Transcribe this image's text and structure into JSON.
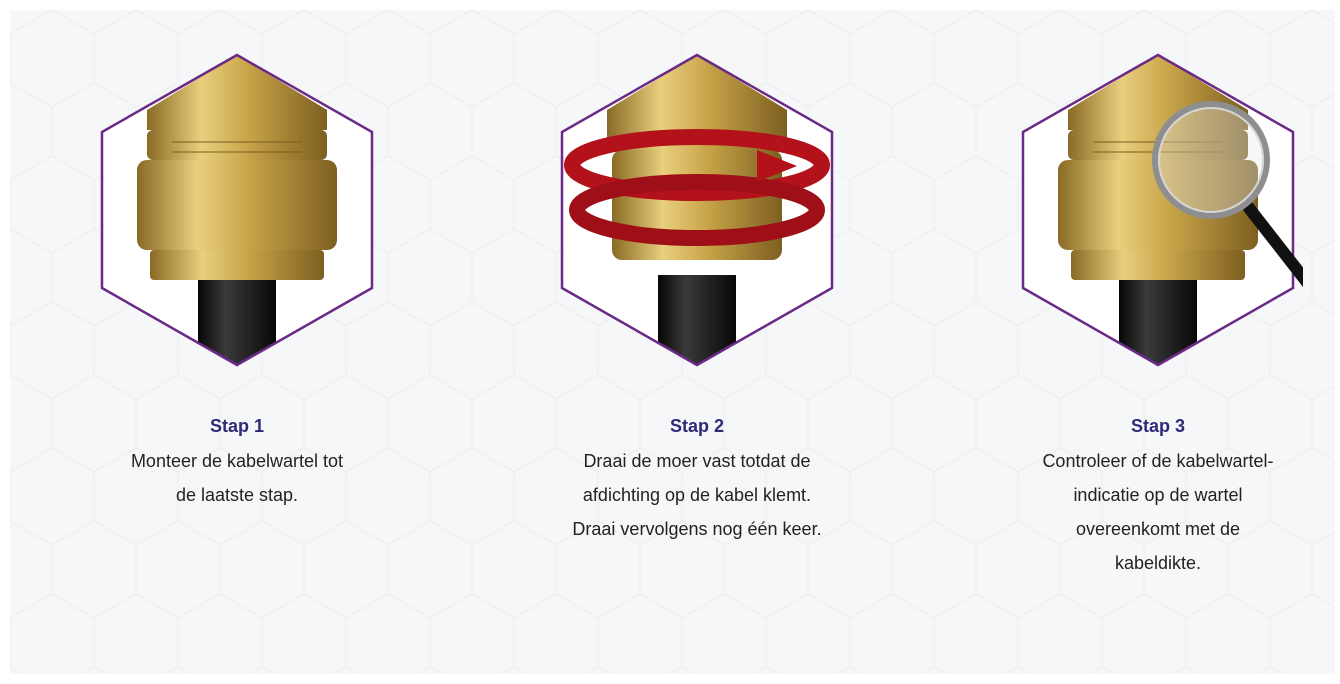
{
  "colors": {
    "hex_border": "#6b2a86",
    "title": "#2e2b78",
    "text": "#222222",
    "brass": "#c9a64a",
    "cable": "#1a1a1a",
    "arrow": "#b3121b",
    "background": "#f6f7f8"
  },
  "steps": [
    {
      "title": "Stap 1",
      "text_lines": [
        "Monteer de kabelwartel tot",
        "de laatste stap."
      ],
      "icon": "cable-gland-icon"
    },
    {
      "title": "Stap 2",
      "text_lines": [
        "Draai de moer vast totdat de",
        "afdichting op de kabel klemt.",
        "Draai vervolgens nog één keer."
      ],
      "icon": "rotate-arrow-icon"
    },
    {
      "title": "Stap 3",
      "text_lines": [
        "Controleer of de kabelwartel-",
        "indicatie op de wartel",
        "overeenkomt met de",
        "kabeldikte."
      ],
      "icon": "magnifier-icon"
    }
  ]
}
